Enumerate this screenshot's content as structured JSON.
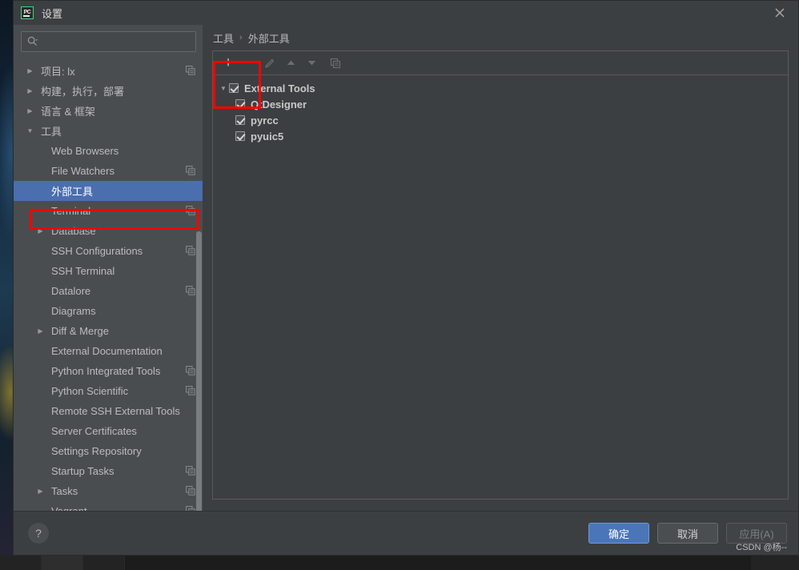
{
  "window": {
    "title": "设置",
    "app_icon_label": "PC",
    "close_icon": "close-icon"
  },
  "search": {
    "value": "",
    "placeholder": "",
    "icon": "search-icon"
  },
  "sidebar": {
    "items": [
      {
        "label": "项目: lx",
        "level": 0,
        "arrow": "▶",
        "expanded": false,
        "selected": false,
        "has_config_icon": true
      },
      {
        "label": "构建，执行，部署",
        "level": 0,
        "arrow": "▶",
        "expanded": false,
        "selected": false,
        "has_config_icon": false
      },
      {
        "label": "语言 & 框架",
        "level": 0,
        "arrow": "▶",
        "expanded": false,
        "selected": false,
        "has_config_icon": false
      },
      {
        "label": "工具",
        "level": 0,
        "arrow": "▼",
        "expanded": true,
        "selected": false,
        "has_config_icon": false
      },
      {
        "label": "Web Browsers",
        "level": 1,
        "arrow": "",
        "expanded": false,
        "selected": false,
        "has_config_icon": false
      },
      {
        "label": "File Watchers",
        "level": 1,
        "arrow": "",
        "expanded": false,
        "selected": false,
        "has_config_icon": true
      },
      {
        "label": "外部工具",
        "level": 1,
        "arrow": "",
        "expanded": false,
        "selected": true,
        "has_config_icon": false
      },
      {
        "label": "Terminal",
        "level": 1,
        "arrow": "",
        "expanded": false,
        "selected": false,
        "has_config_icon": true
      },
      {
        "label": "Database",
        "level": 1,
        "arrow": "▶",
        "expanded": false,
        "selected": false,
        "has_config_icon": false
      },
      {
        "label": "SSH Configurations",
        "level": 1,
        "arrow": "",
        "expanded": false,
        "selected": false,
        "has_config_icon": true
      },
      {
        "label": "SSH Terminal",
        "level": 1,
        "arrow": "",
        "expanded": false,
        "selected": false,
        "has_config_icon": false
      },
      {
        "label": "Datalore",
        "level": 1,
        "arrow": "",
        "expanded": false,
        "selected": false,
        "has_config_icon": true
      },
      {
        "label": "Diagrams",
        "level": 1,
        "arrow": "",
        "expanded": false,
        "selected": false,
        "has_config_icon": false
      },
      {
        "label": "Diff & Merge",
        "level": 1,
        "arrow": "▶",
        "expanded": false,
        "selected": false,
        "has_config_icon": false
      },
      {
        "label": "External Documentation",
        "level": 1,
        "arrow": "",
        "expanded": false,
        "selected": false,
        "has_config_icon": false
      },
      {
        "label": "Python Integrated Tools",
        "level": 1,
        "arrow": "",
        "expanded": false,
        "selected": false,
        "has_config_icon": true
      },
      {
        "label": "Python Scientific",
        "level": 1,
        "arrow": "",
        "expanded": false,
        "selected": false,
        "has_config_icon": true
      },
      {
        "label": "Remote SSH External Tools",
        "level": 1,
        "arrow": "",
        "expanded": false,
        "selected": false,
        "has_config_icon": false
      },
      {
        "label": "Server Certificates",
        "level": 1,
        "arrow": "",
        "expanded": false,
        "selected": false,
        "has_config_icon": false
      },
      {
        "label": "Settings Repository",
        "level": 1,
        "arrow": "",
        "expanded": false,
        "selected": false,
        "has_config_icon": false
      },
      {
        "label": "Startup Tasks",
        "level": 1,
        "arrow": "",
        "expanded": false,
        "selected": false,
        "has_config_icon": true
      },
      {
        "label": "Tasks",
        "level": 1,
        "arrow": "▶",
        "expanded": false,
        "selected": false,
        "has_config_icon": true
      },
      {
        "label": "Vagrant",
        "level": 1,
        "arrow": "",
        "expanded": false,
        "selected": false,
        "has_config_icon": true
      }
    ]
  },
  "breadcrumb": {
    "parent": "工具",
    "separator": "›",
    "current": "外部工具"
  },
  "toolbar": {
    "buttons": [
      {
        "name": "add-button",
        "glyph": "+",
        "disabled": false
      },
      {
        "name": "remove-button",
        "glyph": "−",
        "disabled": true
      },
      {
        "name": "edit-button",
        "glyph": "pencil-icon",
        "disabled": true
      },
      {
        "name": "move-up-button",
        "glyph": "▲",
        "disabled": true
      },
      {
        "name": "move-down-button",
        "glyph": "▼",
        "disabled": true
      },
      {
        "name": "copy-button",
        "glyph": "copy-icon",
        "disabled": true
      }
    ]
  },
  "tools_tree": {
    "group": {
      "label": "External Tools",
      "checked": true,
      "expanded": true,
      "arrow": "▼"
    },
    "children": [
      {
        "label": "QtDesigner",
        "checked": true
      },
      {
        "label": "pyrcc",
        "checked": true
      },
      {
        "label": "pyuic5",
        "checked": true
      }
    ]
  },
  "footer": {
    "help_label": "?",
    "ok_label": "确定",
    "cancel_label": "取消",
    "apply_label": "应用(A)",
    "watermark": "CSDN @杨--"
  },
  "colors": {
    "dialog_bg": "#3c3f41",
    "sidebar_bg": "#4a4d50",
    "selection_blue": "#4b6eaf",
    "ok_button_blue": "#4a76b8",
    "annotation_red": "#fe0000",
    "text_primary": "#bbbbbb"
  }
}
